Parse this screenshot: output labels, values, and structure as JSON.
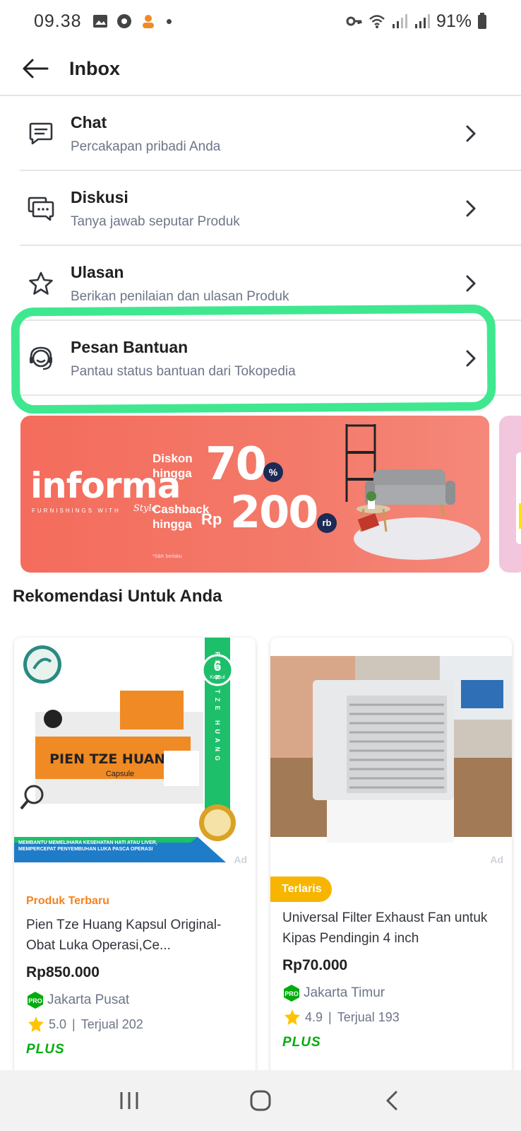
{
  "status_bar": {
    "time": "09.38",
    "battery": "91%"
  },
  "header": {
    "title": "Inbox"
  },
  "inbox_items": [
    {
      "title": "Chat",
      "subtitle": "Percakapan pribadi Anda"
    },
    {
      "title": "Diskusi",
      "subtitle": "Tanya jawab seputar Produk"
    },
    {
      "title": "Ulasan",
      "subtitle": "Berikan penilaian dan ulasan Produk"
    },
    {
      "title": "Pesan Bantuan",
      "subtitle": "Pantau status bantuan dari Tokopedia"
    }
  ],
  "highlight_color": "#3fe88f",
  "banner": {
    "brand": "informa",
    "brand_tagline": "FURNISHINGS WITH",
    "brand_style": "Style",
    "promo1_label": "Diskon\nhingga",
    "promo1_value": "70",
    "promo1_unit": "%",
    "promo2_label": "Cashback\nhingga",
    "promo2_prefix": "Rp",
    "promo2_value": "200",
    "promo2_unit": "rb",
    "terms": "*S&K berlaku",
    "background": "#f46c5c"
  },
  "recommendations": {
    "title": "Rekomendasi Untuk Anda",
    "products": [
      {
        "ad_label": "Ad",
        "badge": "Produk Terbaru",
        "name": "Pien Tze Huang Kapsul Original- Obat Luka Operasi,Ce...",
        "price": "Rp850.000",
        "location": "Jakarta Pusat",
        "rating": "5.0",
        "sold": "Terjual 202",
        "program": "PLUS",
        "image_text": {
          "product_label": "PIEN TZE HUANG",
          "capsule": "Capsule",
          "count": "6",
          "count_unit": "Kapsul",
          "vertical": "PIEN TZE HUANG",
          "tagline": "MEMBANTU MEMELIHARA KESEHATAN HATI ATAU LIVER, MEMPERCEPAT PENYEMBUHAN LUKA PASCA OPERASI"
        }
      },
      {
        "ad_label": "Ad",
        "badge": "Terlaris",
        "name": "Universal Filter Exhaust Fan untuk Kipas Pendingin 4 inch",
        "price": "Rp70.000",
        "location": "Jakarta Timur",
        "rating": "4.9",
        "sold": "Terjual 193",
        "program": "PLUS"
      }
    ]
  },
  "colors": {
    "accent_green": "#03ac0e",
    "badge_orange": "#f4821f",
    "badge_yellow": "#f7b500",
    "star": "#ffc400"
  }
}
